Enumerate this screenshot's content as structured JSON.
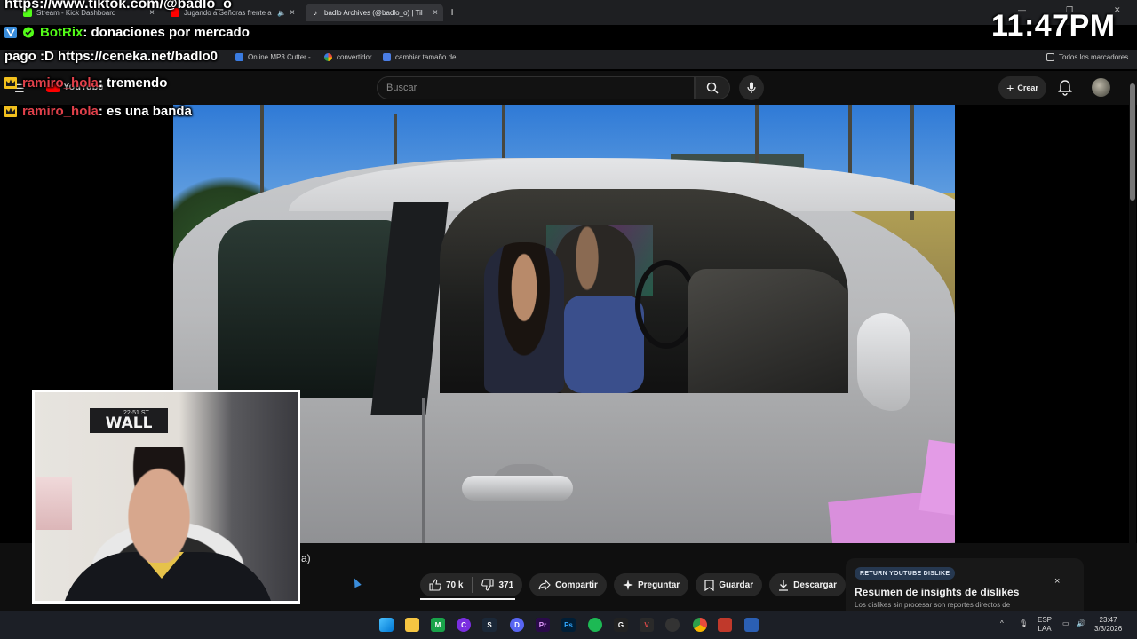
{
  "browser": {
    "tabs": [
      {
        "label": "Stream - Kick Dashboard"
      },
      {
        "label": "Jugando a Señoras frente a"
      },
      {
        "label": "badlo Archives (@badlo_o) | Til"
      }
    ],
    "bookmarks": [
      {
        "label": "Online MP3 Cutter -..."
      },
      {
        "label": "convertidor"
      },
      {
        "label": "cambiar tamaño de..."
      }
    ],
    "all_bookmarks_label": "Todos los marcadores"
  },
  "youtube": {
    "logo_text": "YouTube",
    "search_placeholder": "Buscar",
    "create_label": "Crear"
  },
  "overlay": {
    "url_text": "https://www.tiktok.com/@badlo_o",
    "clock": "11:47PM",
    "chat": [
      {
        "user": "BotRix",
        "user_color": "#53fc18",
        "message": ": donaciones por mercado",
        "badge": "bot"
      },
      {
        "user": "",
        "user_color": "#ffffff",
        "message": "pago :D https://ceneka.net/badlo0",
        "badge": "none"
      },
      {
        "user": "ramiro_hola",
        "user_color": "#e0404a",
        "message": ": tremendo",
        "badge": "crown"
      },
      {
        "user": "ramiro_hola",
        "user_color": "#e0404a",
        "message": ": es una banda",
        "badge": "crown"
      }
    ]
  },
  "webcam": {
    "sign_text": "WALL",
    "sign_small": "22-51 ST"
  },
  "video": {
    "title_fragment": "a)"
  },
  "actions": {
    "likes": "70 k",
    "dislikes": "371",
    "share": "Compartir",
    "ask": "Preguntar",
    "save": "Guardar",
    "download": "Descargar",
    "more": "•••"
  },
  "return_dislike": {
    "badge": "RETURN YOUTUBE DISLIKE",
    "title": "Resumen de insights de dislikes",
    "subtitle": "Los dislikes sin procesar son reportes directos de",
    "close": "×"
  },
  "taskbar": {
    "lang": "ESP",
    "lang_sub": "LAA",
    "time": "23:47",
    "date": "3/3/2026"
  },
  "colors": {
    "youtube_red": "#ff0000",
    "kick_green": "#53fc18",
    "chat_user_red": "#e0404a"
  }
}
